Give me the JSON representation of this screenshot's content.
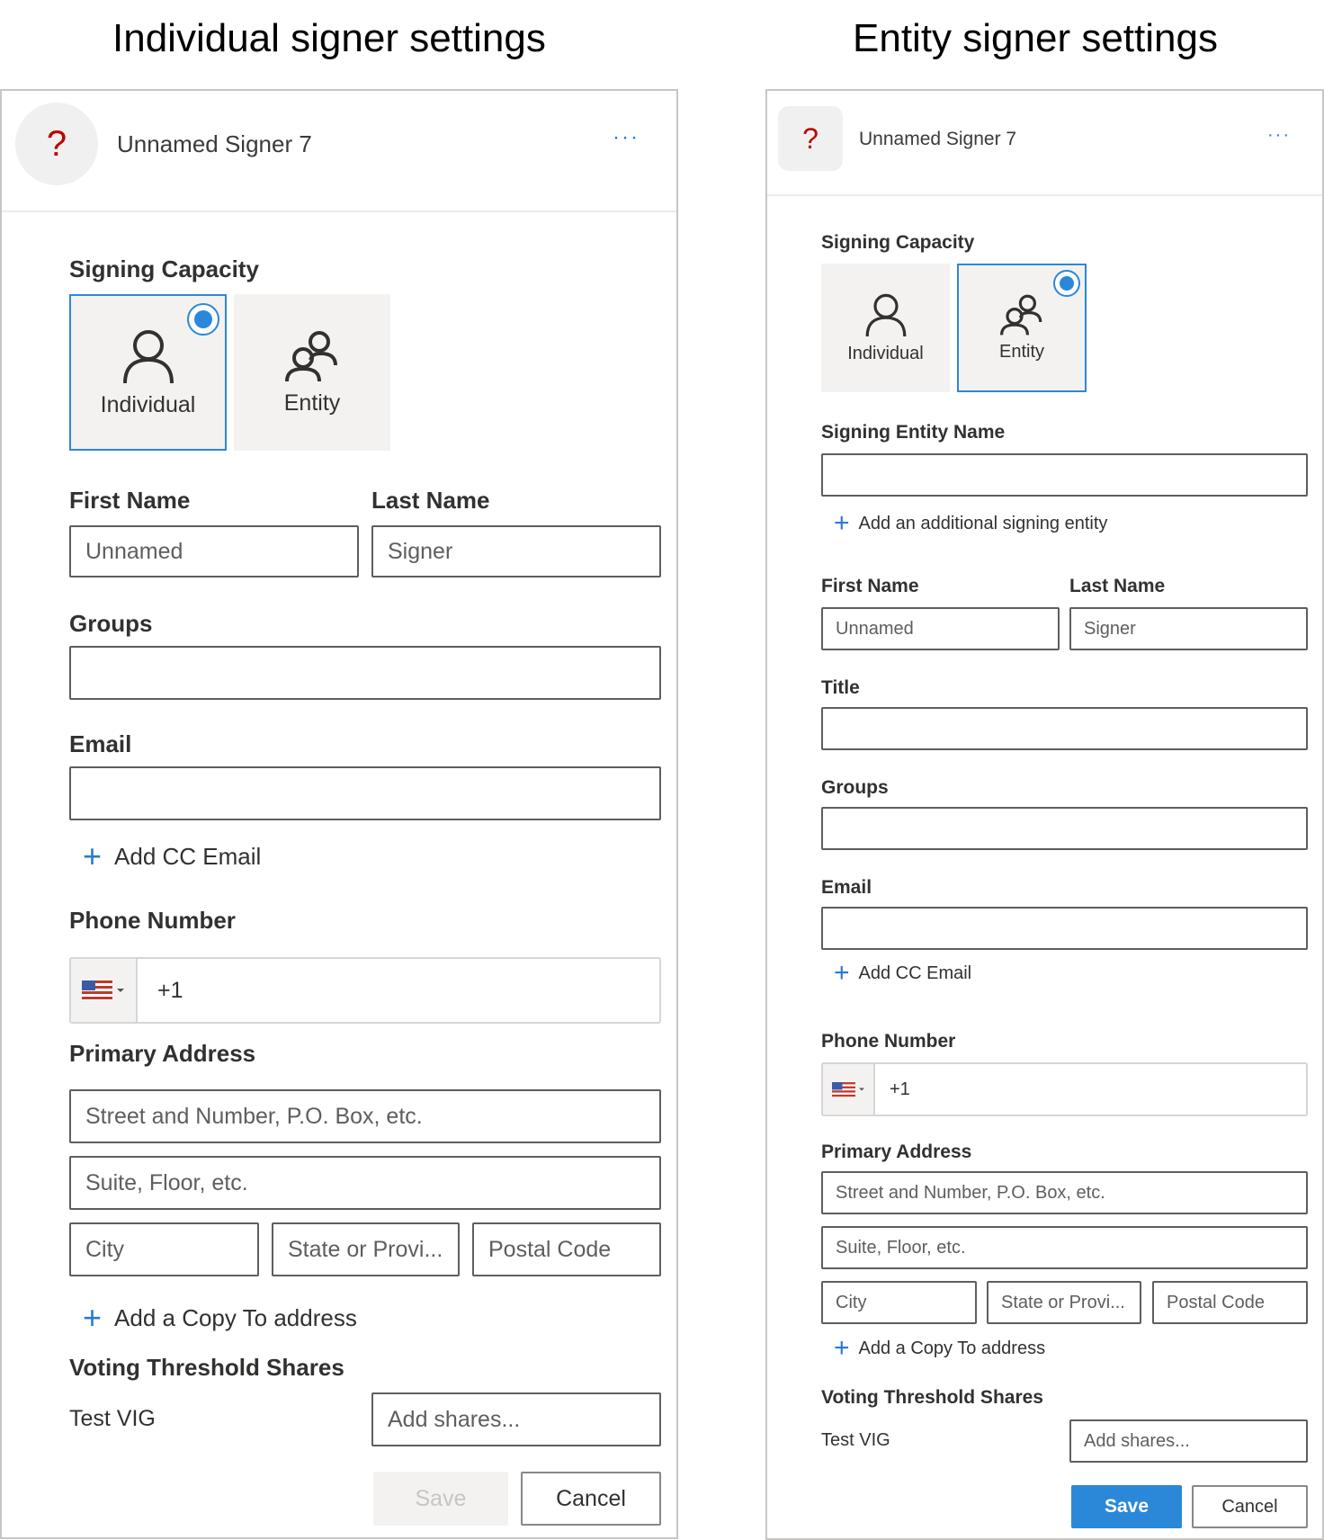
{
  "headings": {
    "left": "Individual signer settings",
    "right": "Entity signer settings"
  },
  "icons": {
    "avatar": "question-mark-icon",
    "more": "more-options-icon",
    "individual": "person-icon",
    "entity": "people-icon",
    "add": "plus-icon",
    "flag": "us-flag-icon",
    "dropdown": "caret-down-icon"
  },
  "colors": {
    "accent": "#2b88d8",
    "avatar_question": "#c00000",
    "border": "#605e5c"
  },
  "individual_panel": {
    "signer_name": "Unnamed Signer 7",
    "avatar_glyph": "?",
    "more_glyph": "···",
    "signing_capacity_label": "Signing Capacity",
    "capacity_individual": "Individual",
    "capacity_entity": "Entity",
    "selected_capacity": "Individual",
    "first_name_label": "First Name",
    "first_name_value": "Unnamed",
    "last_name_label": "Last Name",
    "last_name_value": "Signer",
    "groups_label": "Groups",
    "email_label": "Email",
    "add_cc_email": "Add CC Email",
    "phone_label": "Phone Number",
    "phone_code": "+1",
    "primary_address_label": "Primary Address",
    "street_placeholder": "Street and Number, P.O. Box, etc.",
    "suite_placeholder": "Suite, Floor, etc.",
    "city_placeholder": "City",
    "state_placeholder": "State or Provi...",
    "postal_placeholder": "Postal Code",
    "add_copy_to": "Add a Copy To address",
    "voting_label": "Voting Threshold Shares",
    "vig_name": "Test VIG",
    "shares_placeholder": "Add shares...",
    "save_label": "Save",
    "cancel_label": "Cancel"
  },
  "entity_panel": {
    "signer_name": "Unnamed Signer 7",
    "avatar_glyph": "?",
    "more_glyph": "···",
    "signing_capacity_label": "Signing Capacity",
    "capacity_individual": "Individual",
    "capacity_entity": "Entity",
    "selected_capacity": "Entity",
    "entity_name_label": "Signing Entity Name",
    "add_signing_entity": "Add an additional signing entity",
    "first_name_label": "First Name",
    "first_name_value": "Unnamed",
    "last_name_label": "Last Name",
    "last_name_value": "Signer",
    "title_label": "Title",
    "groups_label": "Groups",
    "email_label": "Email",
    "add_cc_email": "Add CC Email",
    "phone_label": "Phone Number",
    "phone_code": "+1",
    "primary_address_label": "Primary Address",
    "street_placeholder": "Street and Number, P.O. Box, etc.",
    "suite_placeholder": "Suite, Floor, etc.",
    "city_placeholder": "City",
    "state_placeholder": "State or Provi...",
    "postal_placeholder": "Postal Code",
    "add_copy_to": "Add a Copy To address",
    "voting_label": "Voting Threshold Shares",
    "vig_name": "Test VIG",
    "shares_placeholder": "Add shares...",
    "save_label": "Save",
    "cancel_label": "Cancel"
  }
}
